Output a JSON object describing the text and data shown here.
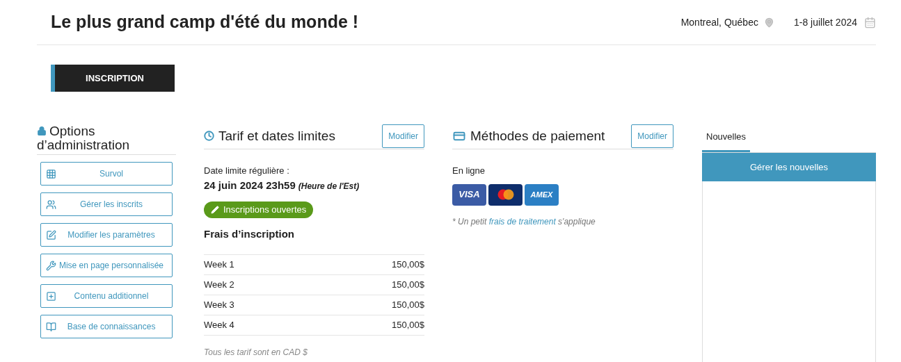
{
  "header": {
    "title": "Le plus grand camp d'été du monde !",
    "location": "Montreal, Québec",
    "dates": "1-8 juillet 2024"
  },
  "nav_tabs": [
    {
      "label": "INSCRIPTION",
      "selected": true
    }
  ],
  "admin": {
    "title": "Options d’administration",
    "buttons": [
      {
        "label": "Survol"
      },
      {
        "label": "Gérer les inscrits"
      },
      {
        "label": "Modifier les paramètres"
      },
      {
        "label": "Mise en page personnalisée"
      },
      {
        "label": "Contenu additionnel"
      },
      {
        "label": "Base de connaissances"
      }
    ]
  },
  "pricing": {
    "title": "Tarif et dates limites",
    "edit_button": "Modifier",
    "deadline_label": "Date limite régulière :",
    "deadline": "24 juin 2024 23h59",
    "timezone": "(Heure de l'Est)",
    "status": {
      "label": "Inscriptions ouvertes",
      "open": true
    },
    "fees_title": "Frais d’inscription",
    "fees": [
      {
        "name": "Week 1",
        "price": "150,00$"
      },
      {
        "name": "Week 2",
        "price": "150,00$"
      },
      {
        "name": "Week 3",
        "price": "150,00$"
      },
      {
        "name": "Week 4",
        "price": "150,00$"
      }
    ],
    "currency_note": "Tous les tarif sont en CAD $"
  },
  "payment": {
    "title": "Méthodes de paiement",
    "edit_button": "Modifier",
    "online_label": "En ligne",
    "cards": [
      {
        "kind": "visa",
        "label": "VISA"
      },
      {
        "kind": "mastercard"
      },
      {
        "kind": "amex",
        "label": "AMEX"
      }
    ],
    "note_before": "* Un petit ",
    "note_link": "frais de traitement",
    "note_after": " s'applique"
  },
  "news": {
    "tabs": [
      {
        "label": "Nouvelles",
        "selected": true
      }
    ],
    "manage_button": "Gérer les nouvelles"
  }
}
